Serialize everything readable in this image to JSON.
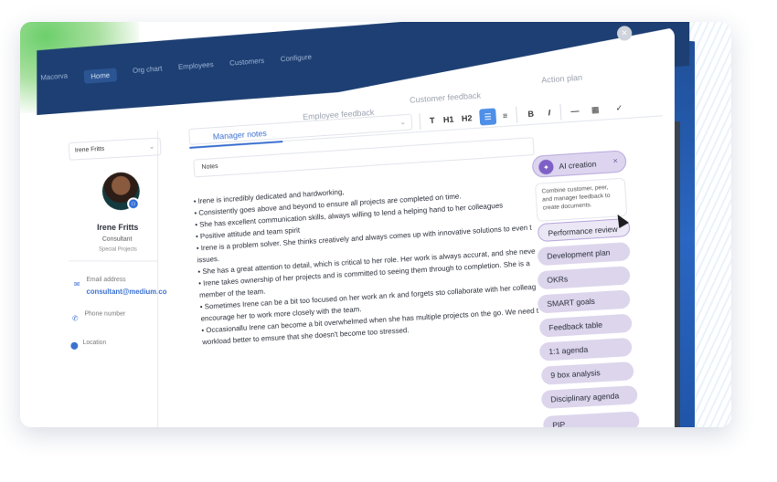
{
  "app": {
    "brand": "Macorva",
    "nav": [
      "Home",
      "Org chart",
      "Employees",
      "Customers",
      "Configure"
    ]
  },
  "tabs": [
    "Manager notes",
    "Employee feedback",
    "Customer feedback",
    "Action plan"
  ],
  "profile": {
    "selector": "Irene Fritts",
    "name": "Irene Fritts",
    "role": "Consultant",
    "department": "Special Projects",
    "email_label": "Email address",
    "email": "consultant@medium.co",
    "phone_label": "Phone number",
    "location_label": "Location"
  },
  "toolbar": [
    "T",
    "H1",
    "H2",
    "B",
    "I"
  ],
  "notes": {
    "label": "Notes",
    "lines": [
      "• Irene is incredibly dedicated and hardworking,",
      "• Consistently goes above and beyond to ensure all projects are completed on time.",
      "• She has excellent communication skills, always willing to lend a helping hand to her colleagues",
      "• Positive attitude and team spirit",
      "• Irene is a problem solver. She thinks creatively and always comes up with innovative solutions to even t",
      "   issues.",
      "• She has a great attention to detail, which is critical to her role. Her work is always accurat, and she neve",
      "• Irene takes ownership of her projects and is committed to seeing them through to completion. She is a",
      "   member of the team.",
      "• Sometimes Irene can be a bit too focused on her work an rk and forgets sto collaborate with her colleag",
      "   encourage her to work more closely with the team.",
      "• Occasionallu Irene can become a bit overwhelmed when she has multiple projects on the go. We need t",
      "   workload better to emsure that she doesn't become too stressed."
    ]
  },
  "ai": {
    "label": "AI creation",
    "description": "Combine customer, peer, and manager feedback to create documents.",
    "items": [
      "Performance review",
      "Development plan",
      "OKRs",
      "SMART goals",
      "Feedback table",
      "1:1 agenda",
      "9 box analysis",
      "Disciplinary agenda",
      "PIP"
    ]
  }
}
